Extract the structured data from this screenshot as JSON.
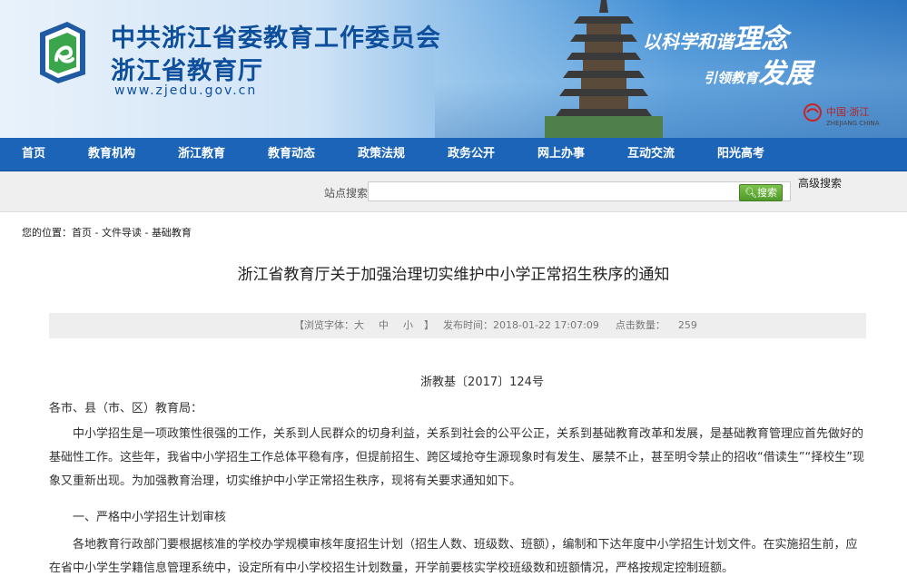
{
  "banner": {
    "title_cn1": "中共浙江省委教育工作委员会",
    "title_cn2": "浙江省教育厅",
    "url": "www.zjedu.gov.cn",
    "slogan1_prefix": "以科学和谐",
    "slogan1_big": "理念",
    "slogan2_prefix": "引领教育",
    "slogan2_big": "发展",
    "china_zj": "中国·浙江",
    "china_zj_en": "ZHEJIANG CHINA"
  },
  "nav": {
    "items": [
      "首页",
      "教育机构",
      "浙江教育",
      "教育动态",
      "政策法规",
      "政务公开",
      "网上办事",
      "互动交流",
      "阳光高考"
    ]
  },
  "search": {
    "label": "站点搜索",
    "value": "",
    "button": "搜索",
    "advanced": "高级搜索"
  },
  "breadcrumb": {
    "prefix": "您的位置：",
    "items": [
      "首页",
      "文件导读",
      "基础教育"
    ],
    "separator": " - "
  },
  "article": {
    "title": "浙江省教育厅关于加强治理切实维护中小学正常招生秩序的通知",
    "meta_font_label": "【浏览字体：",
    "meta_font_large": "大",
    "meta_font_medium": "中",
    "meta_font_small": "小",
    "meta_font_end": "】",
    "meta_time_label": "发布时间：",
    "meta_time": "2018-01-22 17:07:09",
    "meta_count_label": "点击数量：",
    "meta_count": "259",
    "doc_number": "浙教基〔2017〕124号",
    "salutation": "各市、县（市、区）教育局：",
    "paragraph1": "中小学招生是一项政策性很强的工作，关系到人民群众的切身利益，关系到社会的公平公正，关系到基础教育改革和发展，是基础教育管理应首先做好的基础性工作。这些年，我省中小学招生工作总体平稳有序，但提前招生、跨区域抢夺生源现象时有发生、屡禁不止，甚至明令禁止的招收“借读生”“择校生”现象又重新出现。为加强教育治理，切实维护中小学正常招生秩序，现将有关要求通知如下。",
    "section1": "一、严格中小学招生计划审核",
    "paragraph2": "各地教育行政部门要根据核准的学校办学规模审核年度招生计划（招生人数、班级数、班额），编制和下达年度中小学招生计划文件。在实施招生前，应在省中小学生学籍信息管理系统中，设定所有中小学校招生计划数量，开学前要核实学校班级数和班额情况，严格按规定控制班额。"
  },
  "colors": {
    "nav_bg": "#1b64b7",
    "title_blue": "#0d4f9c",
    "search_btn_green": "#5aa733"
  }
}
